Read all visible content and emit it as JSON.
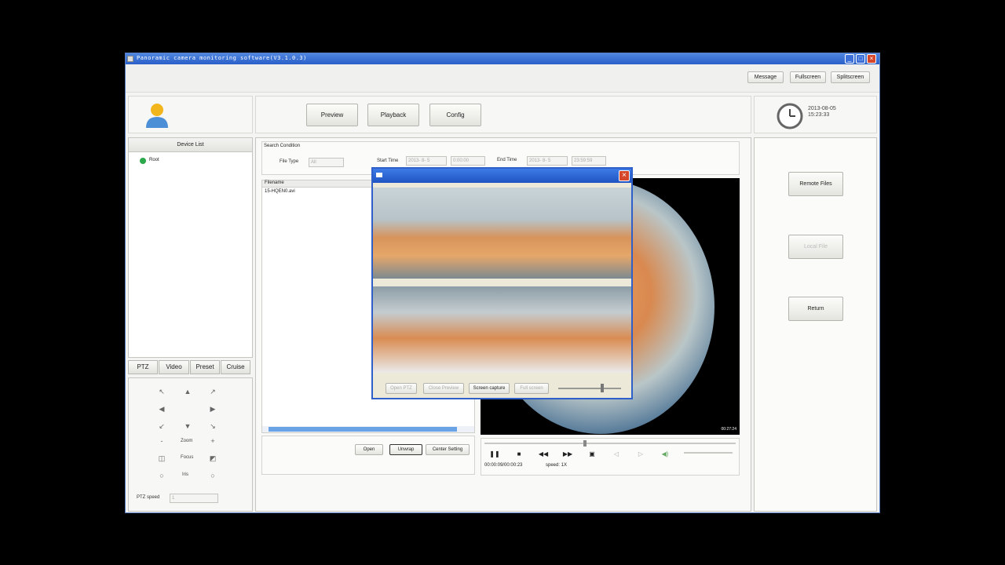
{
  "window": {
    "title": "Panoramic camera monitoring software(V3.1.0.3)",
    "controls": {
      "minimize": "_",
      "maximize": "□",
      "close": "×"
    }
  },
  "top_menu": {
    "message": "Message",
    "fullscreen": "Fullscreen",
    "splitscreen": "Splitscreen"
  },
  "nav": {
    "preview": "Preview",
    "playback": "Playback",
    "config": "Config"
  },
  "clock": {
    "date": "2013-08-05",
    "time": "15:23:33"
  },
  "device_list": {
    "header": "Device List",
    "root": "Root"
  },
  "ptz_tabs": {
    "ptz": "PTZ",
    "video": "Video",
    "preset": "Preset",
    "cruise": "Cruise"
  },
  "ptz": {
    "zoom": "Zoom",
    "focus": "Focus",
    "iris": "Iris",
    "speed_label": "PTZ speed",
    "speed_value": "1"
  },
  "search": {
    "title": "Search Condition",
    "file_type_label": "File Type",
    "file_type_value": "All",
    "start_time_label": "Start Time",
    "start_date": "2013- 8- 5",
    "start_clock": "0:00:00",
    "end_time_label": "End Time",
    "end_date": "2013- 8- 5",
    "end_clock": "23:59:59"
  },
  "file_list": {
    "header": "Filename",
    "rows": [
      "15-HQEN0.avi"
    ]
  },
  "file_buttons": {
    "open": "Open",
    "unwrap": "Unwrap",
    "center_setting": "Center Setting"
  },
  "popup": {
    "open_ptz": "Open PTZ",
    "close_preview": "Close Preview",
    "screen_capture": "Screen capture",
    "full_screen": "Full screen",
    "close": "×"
  },
  "player": {
    "timecode": "00:00:09/00:00:23",
    "speed": "speed: 1X",
    "overlay_time": "00:27:24"
  },
  "side": {
    "remote_files": "Remote Files",
    "local_files": "Local File",
    "return": "Return"
  },
  "colors": {
    "titlebar": "#2a5fc8",
    "close": "#d5462a",
    "panel_border": "#c6c6c0",
    "scroll": "#6aa2e6"
  }
}
